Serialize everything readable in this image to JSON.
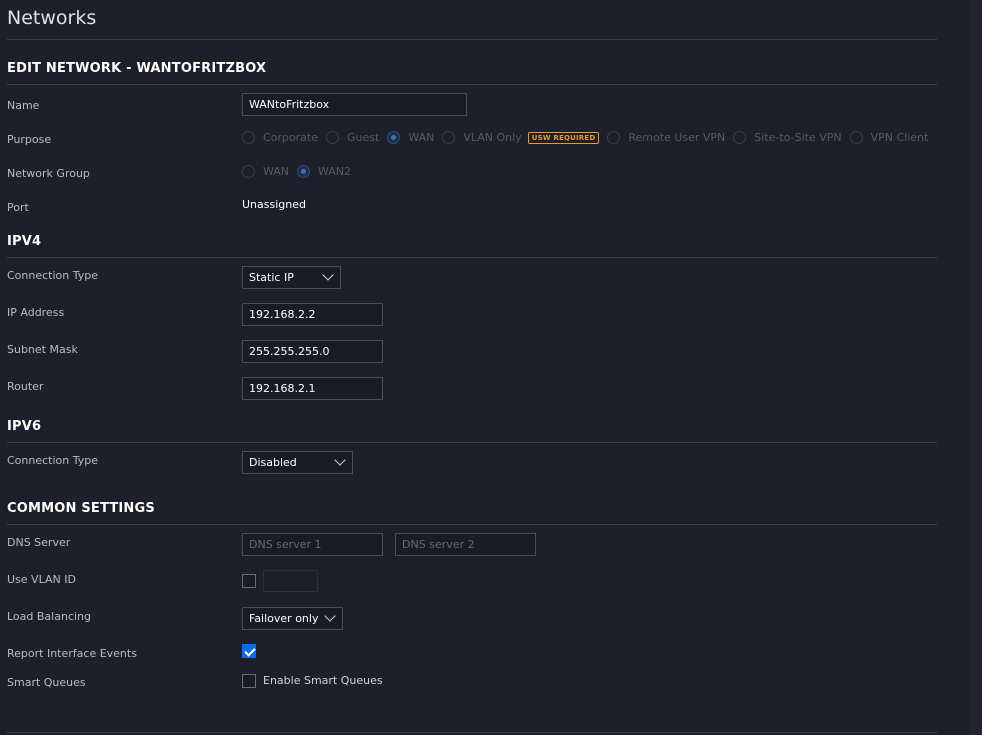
{
  "page": {
    "title": "Networks"
  },
  "edit_section": {
    "title": "EDIT NETWORK - WANTOFRITZBOX",
    "name_label": "Name",
    "name_value": "WANtoFritzbox",
    "purpose_label": "Purpose",
    "purpose_options": [
      {
        "label": "Corporate",
        "checked": false
      },
      {
        "label": "Guest",
        "checked": false
      },
      {
        "label": "WAN",
        "checked": true
      },
      {
        "label": "VLAN Only",
        "checked": false
      },
      {
        "label": "Remote User VPN",
        "checked": false
      },
      {
        "label": "Site-to-Site VPN",
        "checked": false
      },
      {
        "label": "VPN Client",
        "checked": false
      }
    ],
    "usw_badge": "USW REQUIRED",
    "network_group_label": "Network Group",
    "network_group_options": [
      {
        "label": "WAN",
        "checked": false
      },
      {
        "label": "WAN2",
        "checked": true
      }
    ],
    "port_label": "Port",
    "port_value": "Unassigned"
  },
  "ipv4": {
    "title": "IPV4",
    "connection_type_label": "Connection Type",
    "connection_type_value": "Static IP",
    "ip_label": "IP Address",
    "ip_value": "192.168.2.2",
    "subnet_label": "Subnet Mask",
    "subnet_value": "255.255.255.0",
    "router_label": "Router",
    "router_value": "192.168.2.1"
  },
  "ipv6": {
    "title": "IPV6",
    "connection_type_label": "Connection Type",
    "connection_type_value": "Disabled"
  },
  "common": {
    "title": "COMMON SETTINGS",
    "dns_label": "DNS Server",
    "dns1_placeholder": "DNS server 1",
    "dns2_placeholder": "DNS server 2",
    "vlan_label": "Use VLAN ID",
    "vlan_checked": false,
    "load_balancing_label": "Load Balancing",
    "load_balancing_value": "Failover only",
    "report_events_label": "Report Interface Events",
    "report_events_checked": true,
    "smart_queues_label": "Smart Queues",
    "smart_queues_option": "Enable Smart Queues",
    "smart_queues_checked": false
  },
  "colors": {
    "background": "#1d1f2a",
    "accent": "#0a6ee8",
    "badge": "#e89b2b"
  }
}
